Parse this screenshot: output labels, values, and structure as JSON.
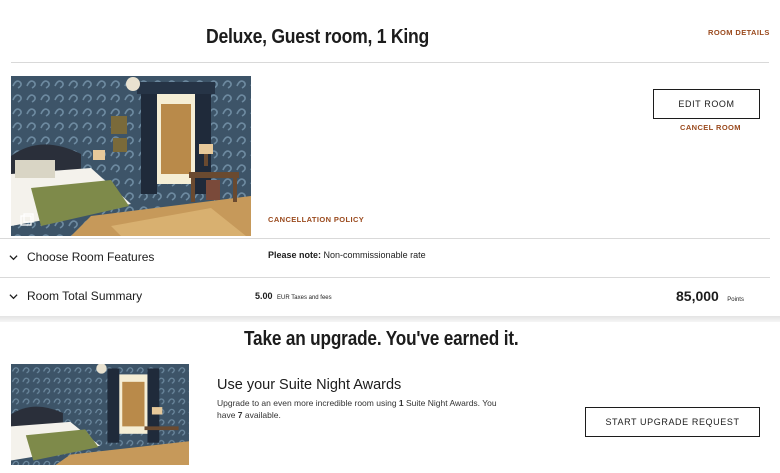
{
  "room": {
    "title": "Deluxe, Guest room, 1 King",
    "details_link": "ROOM DETAILS",
    "edit_button": "EDIT ROOM",
    "cancel_link": "CANCEL ROOM",
    "cancellation_policy": "CANCELLATION POLICY"
  },
  "features": {
    "label": "Choose Room Features",
    "note_label": "Please note:",
    "note_text": "Non-commissionable rate"
  },
  "summary": {
    "label": "Room Total Summary",
    "taxes_amount": "5.00",
    "taxes_label": "EUR Taxes and fees",
    "total_points": "85,000",
    "points_unit": "Points"
  },
  "upgrade": {
    "heading": "Take an upgrade. You've earned it.",
    "title": "Use your Suite Night Awards",
    "desc_prefix": "Upgrade to an even more incredible room using ",
    "desc_count": "1",
    "desc_middle": " Suite Night Awards. You have ",
    "desc_available": "7",
    "desc_suffix": " available.",
    "button": "START UPGRADE REQUEST"
  },
  "icons": [
    "gallery-icon",
    "chevron-down-icon"
  ],
  "colors": {
    "accent": "#9a4a1e",
    "text": "#1c1c1c",
    "divider": "#d9d9d9"
  }
}
